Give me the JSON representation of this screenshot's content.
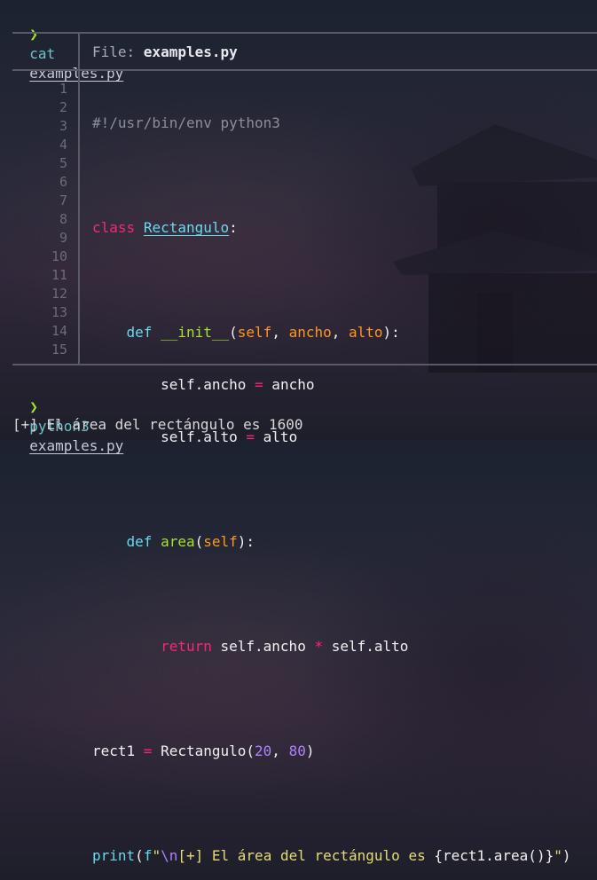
{
  "prompt_symbol": "❯",
  "cmd1": {
    "command": "cat",
    "argument": "examples.py"
  },
  "viewer": {
    "file_label": "File: ",
    "file_name": "examples.py",
    "line_numbers": [
      "1",
      "2",
      "3",
      "4",
      "5",
      "6",
      "7",
      "8",
      "9",
      "10",
      "11",
      "12",
      "13",
      "14",
      "15"
    ],
    "code": {
      "l1": "#!/usr/bin/env python3",
      "l3_kw": "class",
      "l3_name": "Rectangulo",
      "l3_colon": ":",
      "l5_indent": "    ",
      "l5_kw": "def",
      "l5_fn": "__init__",
      "l5_open": "(",
      "l5_self": "self",
      "l5_c1": ", ",
      "l5_p1": "ancho",
      "l5_c2": ", ",
      "l5_p2": "alto",
      "l5_close": "):",
      "l6_a": "        self.ancho ",
      "l6_op": "=",
      "l6_b": " ancho",
      "l7_a": "        self.alto ",
      "l7_op": "=",
      "l7_b": " alto",
      "l9_indent": "    ",
      "l9_kw": "def",
      "l9_fn": "area",
      "l9_open": "(",
      "l9_self": "self",
      "l9_close": "):",
      "l11_indent": "        ",
      "l11_kw": "return",
      "l11_a": " self.ancho ",
      "l11_op": "*",
      "l11_b": " self.alto",
      "l13_a": "rect1 ",
      "l13_op": "=",
      "l13_b": " Rectangulo(",
      "l13_n1": "20",
      "l13_comma": ", ",
      "l13_n2": "80",
      "l13_close": ")",
      "l15_fn": "print",
      "l15_open": "(",
      "l15_f": "f",
      "l15_q": "\"",
      "l15_esc": "\\n",
      "l15_str": "[+] El área del rectángulo es ",
      "l15_expr": "{rect1.area()}",
      "l15_q2": "\"",
      "l15_close": ")"
    }
  },
  "cmd2": {
    "command": "python3",
    "argument": "examples.py"
  },
  "output": "[+] El área del rectángulo es 1600"
}
